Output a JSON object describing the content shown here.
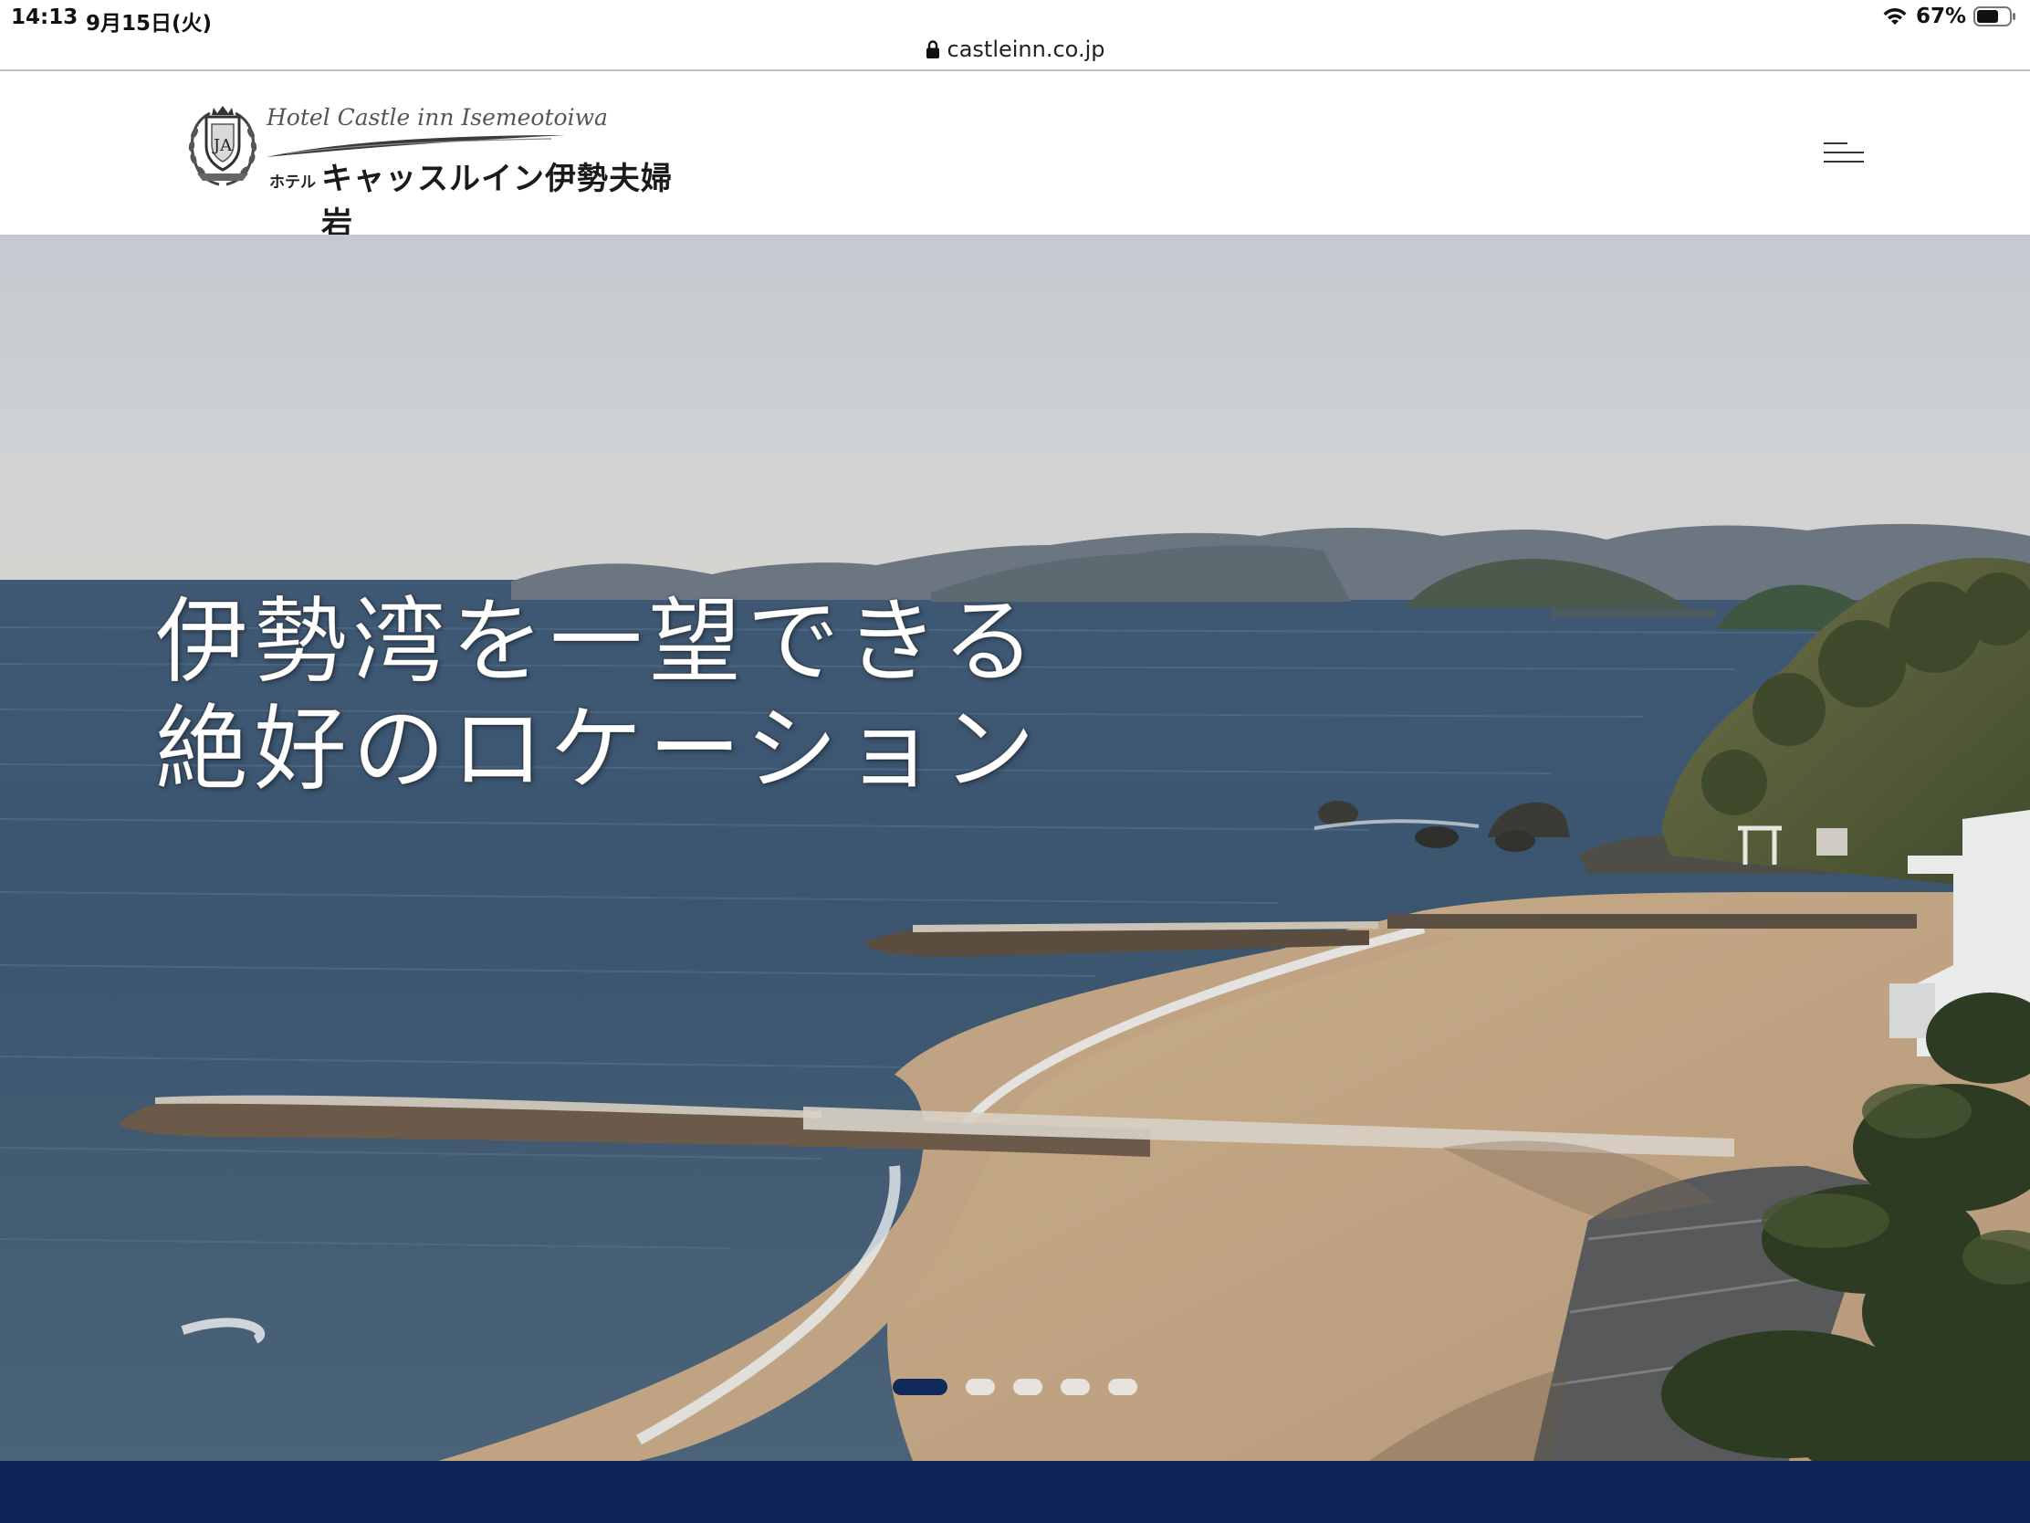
{
  "status_bar": {
    "time": "14:13",
    "date": "9月15日(火)",
    "battery_percent": "67%",
    "wifi_icon": "wifi-icon",
    "battery_icon": "battery-icon",
    "battery_level": 0.67
  },
  "browser": {
    "url": "castleinn.co.jp",
    "lock_icon": "lock-icon"
  },
  "header": {
    "logo_en": "Hotel Castle inn Isemeotoiwa",
    "logo_prefix": "ホテル",
    "logo_jp": "キャッスルイン伊勢夫婦岩",
    "menu_icon": "hamburger-menu-icon"
  },
  "hero": {
    "caption_line1": "伊勢湾を一望できる",
    "caption_line2": "絶好のロケーション",
    "slides_total": 5,
    "active_slide": 1
  },
  "colors": {
    "brand_navy": "#0f2358",
    "dot_active": "#12295c",
    "dot_inactive": "#e6e3df"
  }
}
